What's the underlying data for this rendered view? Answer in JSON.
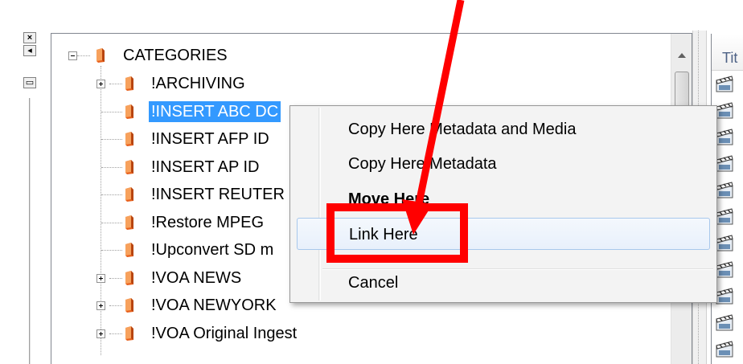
{
  "toolbar": {
    "close_glyph": "×",
    "nav_glyph": "◂",
    "layout_glyph": "▭"
  },
  "tree": {
    "root_label": "CATEGORIES",
    "items": [
      {
        "label": "!ARCHIVING",
        "expandable": true,
        "selected": false
      },
      {
        "label": "!INSERT ABC DC",
        "expandable": false,
        "selected": true
      },
      {
        "label": "!INSERT AFP ID",
        "expandable": false,
        "selected": false
      },
      {
        "label": "!INSERT AP ID",
        "expandable": false,
        "selected": false
      },
      {
        "label": "!INSERT REUTER",
        "expandable": false,
        "selected": false
      },
      {
        "label": "!Restore MPEG",
        "expandable": false,
        "selected": false
      },
      {
        "label": "!Upconvert SD m",
        "expandable": false,
        "selected": false
      },
      {
        "label": "!VOA NEWS",
        "expandable": true,
        "selected": false
      },
      {
        "label": "!VOA NEWYORK",
        "expandable": true,
        "selected": false
      },
      {
        "label": "!VOA Original Ingest",
        "expandable": true,
        "selected": false
      }
    ]
  },
  "right_panel": {
    "column_header": "Tit"
  },
  "context_menu": {
    "items": [
      {
        "label": "Copy Here Metadata and Media",
        "bold": false
      },
      {
        "label": "Copy Here Metadata",
        "bold": false
      },
      {
        "label": "Move Here",
        "bold": true
      },
      {
        "label": "Link Here",
        "bold": false,
        "hover": true
      },
      {
        "label": "Cancel",
        "bold": false
      }
    ]
  },
  "colors": {
    "selection": "#3399ff",
    "annotation": "#ff0000",
    "folder_orange": "#e8611c"
  },
  "icons": {
    "folder": "book-folder-icon",
    "expander": "tree-expander-icon",
    "clip": "media-clip-icon"
  }
}
